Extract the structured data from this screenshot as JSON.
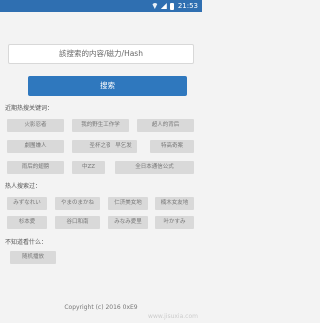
{
  "statusbar": {
    "time": "21:53"
  },
  "search": {
    "placeholder": "該搜索的内容/磁力/Hash",
    "button_label": "搜索"
  },
  "sections": {
    "recent_label": "近期热搜关键词：",
    "recent_tags": [
      "火影忍者",
      "我的野生工作学",
      "超人的背后",
      "劇團嫌人",
      "圣杯之夜",
      "早乞发",
      "特高奇案",
      "雨后的翅膀",
      "中ZZ",
      "全日本通信公式"
    ],
    "hot_label": "热人搜索过：",
    "hot_tags": [
      "みずなれい",
      "やまのまかね",
      "仁济美女地",
      "楠木女友地",
      "杉本愛",
      "谷口和南",
      "みなみ愛里",
      "叶かすみ"
    ],
    "unknown_label": "不知道看什么：",
    "random_label": "随机播放"
  },
  "footer": {
    "copyright": "Copyright (c) 2016 0xE9"
  },
  "watermark": "www.jisuxia.com"
}
